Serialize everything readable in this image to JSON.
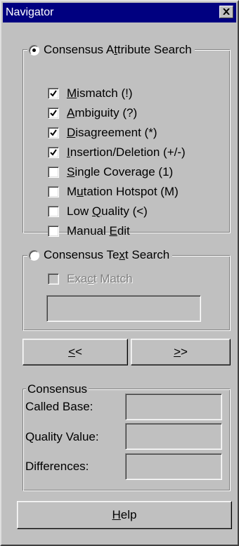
{
  "window": {
    "title": "Navigator"
  },
  "attribute_search": {
    "label": "Consensus Attribute Search",
    "selected": true,
    "options": [
      {
        "label": "Mismatch (!)",
        "checked": true
      },
      {
        "label": "Ambiguity (?)",
        "checked": true
      },
      {
        "label": "Disagreement (*)",
        "checked": true
      },
      {
        "label": "Insertion/Deletion (+/-)",
        "checked": true
      },
      {
        "label": "Single Coverage (1)",
        "checked": false
      },
      {
        "label": "Mutation Hotspot (M)",
        "checked": false
      },
      {
        "label": "Low Quality (<)",
        "checked": false
      },
      {
        "label": "Manual Edit",
        "checked": false
      }
    ]
  },
  "text_search": {
    "label": "Consensus Text Search",
    "selected": false,
    "exact_match_label": "Exact Match",
    "exact_match_checked": false,
    "search_value": ""
  },
  "nav": {
    "prev_label": "<<",
    "next_label": ">>"
  },
  "consensus": {
    "label": "Consensus",
    "called_base_label": "Called Base:",
    "called_base_value": "",
    "quality_value_label": "Quality Value:",
    "quality_value_value": "",
    "differences_label": "Differences:",
    "differences_value": ""
  },
  "help_label": "Help"
}
